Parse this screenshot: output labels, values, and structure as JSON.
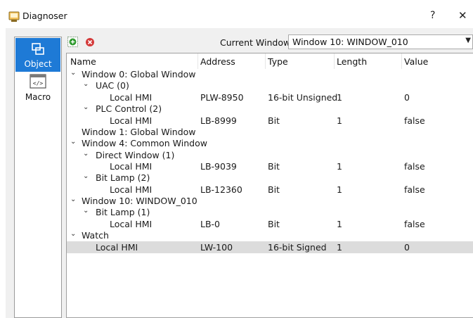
{
  "window": {
    "title": "Diagnoser",
    "help": "?",
    "close": "✕"
  },
  "leftbar": {
    "object_label": "Object",
    "macro_label": "Macro"
  },
  "toolbar": {
    "current_window_label": "Current Window:",
    "current_window_value": "Window 10: WINDOW_010"
  },
  "columns": [
    "Name",
    "Address",
    "Type",
    "Length",
    "Value"
  ],
  "rows": [
    {
      "name": "Window 0: Global Window",
      "address": "",
      "type": "",
      "length": "",
      "value": ""
    },
    {
      "name": "UAC (0)",
      "address": "",
      "type": "",
      "length": "",
      "value": ""
    },
    {
      "name": "Local HMI",
      "address": "PLW-8950",
      "type": "16-bit Unsigned",
      "length": "1",
      "value": "0"
    },
    {
      "name": "PLC Control (2)",
      "address": "",
      "type": "",
      "length": "",
      "value": ""
    },
    {
      "name": "Local HMI",
      "address": "LB-8999",
      "type": "Bit",
      "length": "1",
      "value": "false"
    },
    {
      "name": "Window 1: Global Window",
      "address": "",
      "type": "",
      "length": "",
      "value": ""
    },
    {
      "name": "Window 4: Common Window",
      "address": "",
      "type": "",
      "length": "",
      "value": ""
    },
    {
      "name": "Direct Window (1)",
      "address": "",
      "type": "",
      "length": "",
      "value": ""
    },
    {
      "name": "Local HMI",
      "address": "LB-9039",
      "type": "Bit",
      "length": "1",
      "value": "false"
    },
    {
      "name": "Bit Lamp (2)",
      "address": "",
      "type": "",
      "length": "",
      "value": ""
    },
    {
      "name": "Local HMI",
      "address": "LB-12360",
      "type": "Bit",
      "length": "1",
      "value": "false"
    },
    {
      "name": "Window 10: WINDOW_010",
      "address": "",
      "type": "",
      "length": "",
      "value": ""
    },
    {
      "name": "Bit Lamp (1)",
      "address": "",
      "type": "",
      "length": "",
      "value": ""
    },
    {
      "name": "Local HMI",
      "address": "LB-0",
      "type": "Bit",
      "length": "1",
      "value": "false"
    },
    {
      "name": "Watch",
      "address": "",
      "type": "",
      "length": "",
      "value": ""
    },
    {
      "name": "Local HMI",
      "address": "LW-100",
      "type": "16-bit Signed",
      "length": "1",
      "value": "0"
    }
  ],
  "icons": {
    "add": "add-icon",
    "delete": "delete-icon",
    "object": "object-icon",
    "macro": "macro-icon",
    "chevron": "chevron-down-icon"
  },
  "colors": {
    "selected_tab": "#1e7ad6",
    "selected_row": "#dcdcdc",
    "add_green": "#2e9a2e",
    "delete_red": "#d43a3a"
  }
}
